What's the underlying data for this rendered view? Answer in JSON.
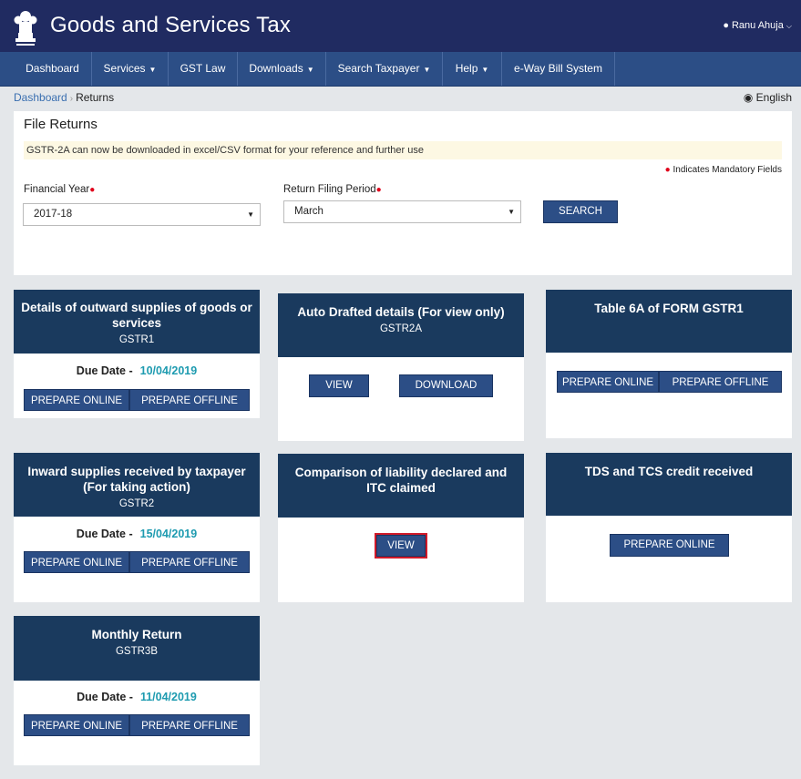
{
  "header": {
    "title": "Goods and Services Tax",
    "user": "Ranu Ahuja"
  },
  "nav": [
    "Dashboard",
    "Services",
    "GST Law",
    "Downloads",
    "Search Taxpayer",
    "Help",
    "e-Way Bill System"
  ],
  "breadcrumb": {
    "home": "Dashboard",
    "current": "Returns"
  },
  "language": "English",
  "file_returns": {
    "title": "File Returns",
    "notice": "GSTR-2A can now be downloaded in excel/CSV format for your reference and further use",
    "mandatory": "Indicates Mandatory Fields",
    "financial_year_label": "Financial Year",
    "financial_year_value": "2017-18",
    "period_label": "Return Filing Period",
    "period_value": "March",
    "search_label": "SEARCH"
  },
  "cards": {
    "gstr1": {
      "title": "Details of outward supplies of goods or services",
      "code": "GSTR1",
      "due_label": "Due Date -",
      "due_value": "10/04/2019",
      "btn1": "PREPARE ONLINE",
      "btn2": "PREPARE OFFLINE"
    },
    "gstr2a": {
      "title": "Auto Drafted details (For view only)",
      "code": "GSTR2A",
      "btn1": "VIEW",
      "btn2": "DOWNLOAD"
    },
    "table6a": {
      "title": "Table 6A of FORM GSTR1",
      "btn1": "PREPARE ONLINE",
      "btn2": "PREPARE OFFLINE"
    },
    "gstr2": {
      "title": "Inward supplies received by taxpayer (For taking action)",
      "code": "GSTR2",
      "due_label": "Due Date -",
      "due_value": "15/04/2019",
      "btn1": "PREPARE ONLINE",
      "btn2": "PREPARE OFFLINE"
    },
    "comparison": {
      "title": "Comparison of liability declared and ITC claimed",
      "btn1": "VIEW"
    },
    "tds": {
      "title": "TDS and TCS credit received",
      "btn1": "PREPARE ONLINE"
    },
    "gstr3b": {
      "title": "Monthly Return",
      "code": "GSTR3B",
      "due_label": "Due Date -",
      "due_value": "11/04/2019",
      "btn1": "PREPARE ONLINE",
      "btn2": "PREPARE OFFLINE"
    }
  }
}
